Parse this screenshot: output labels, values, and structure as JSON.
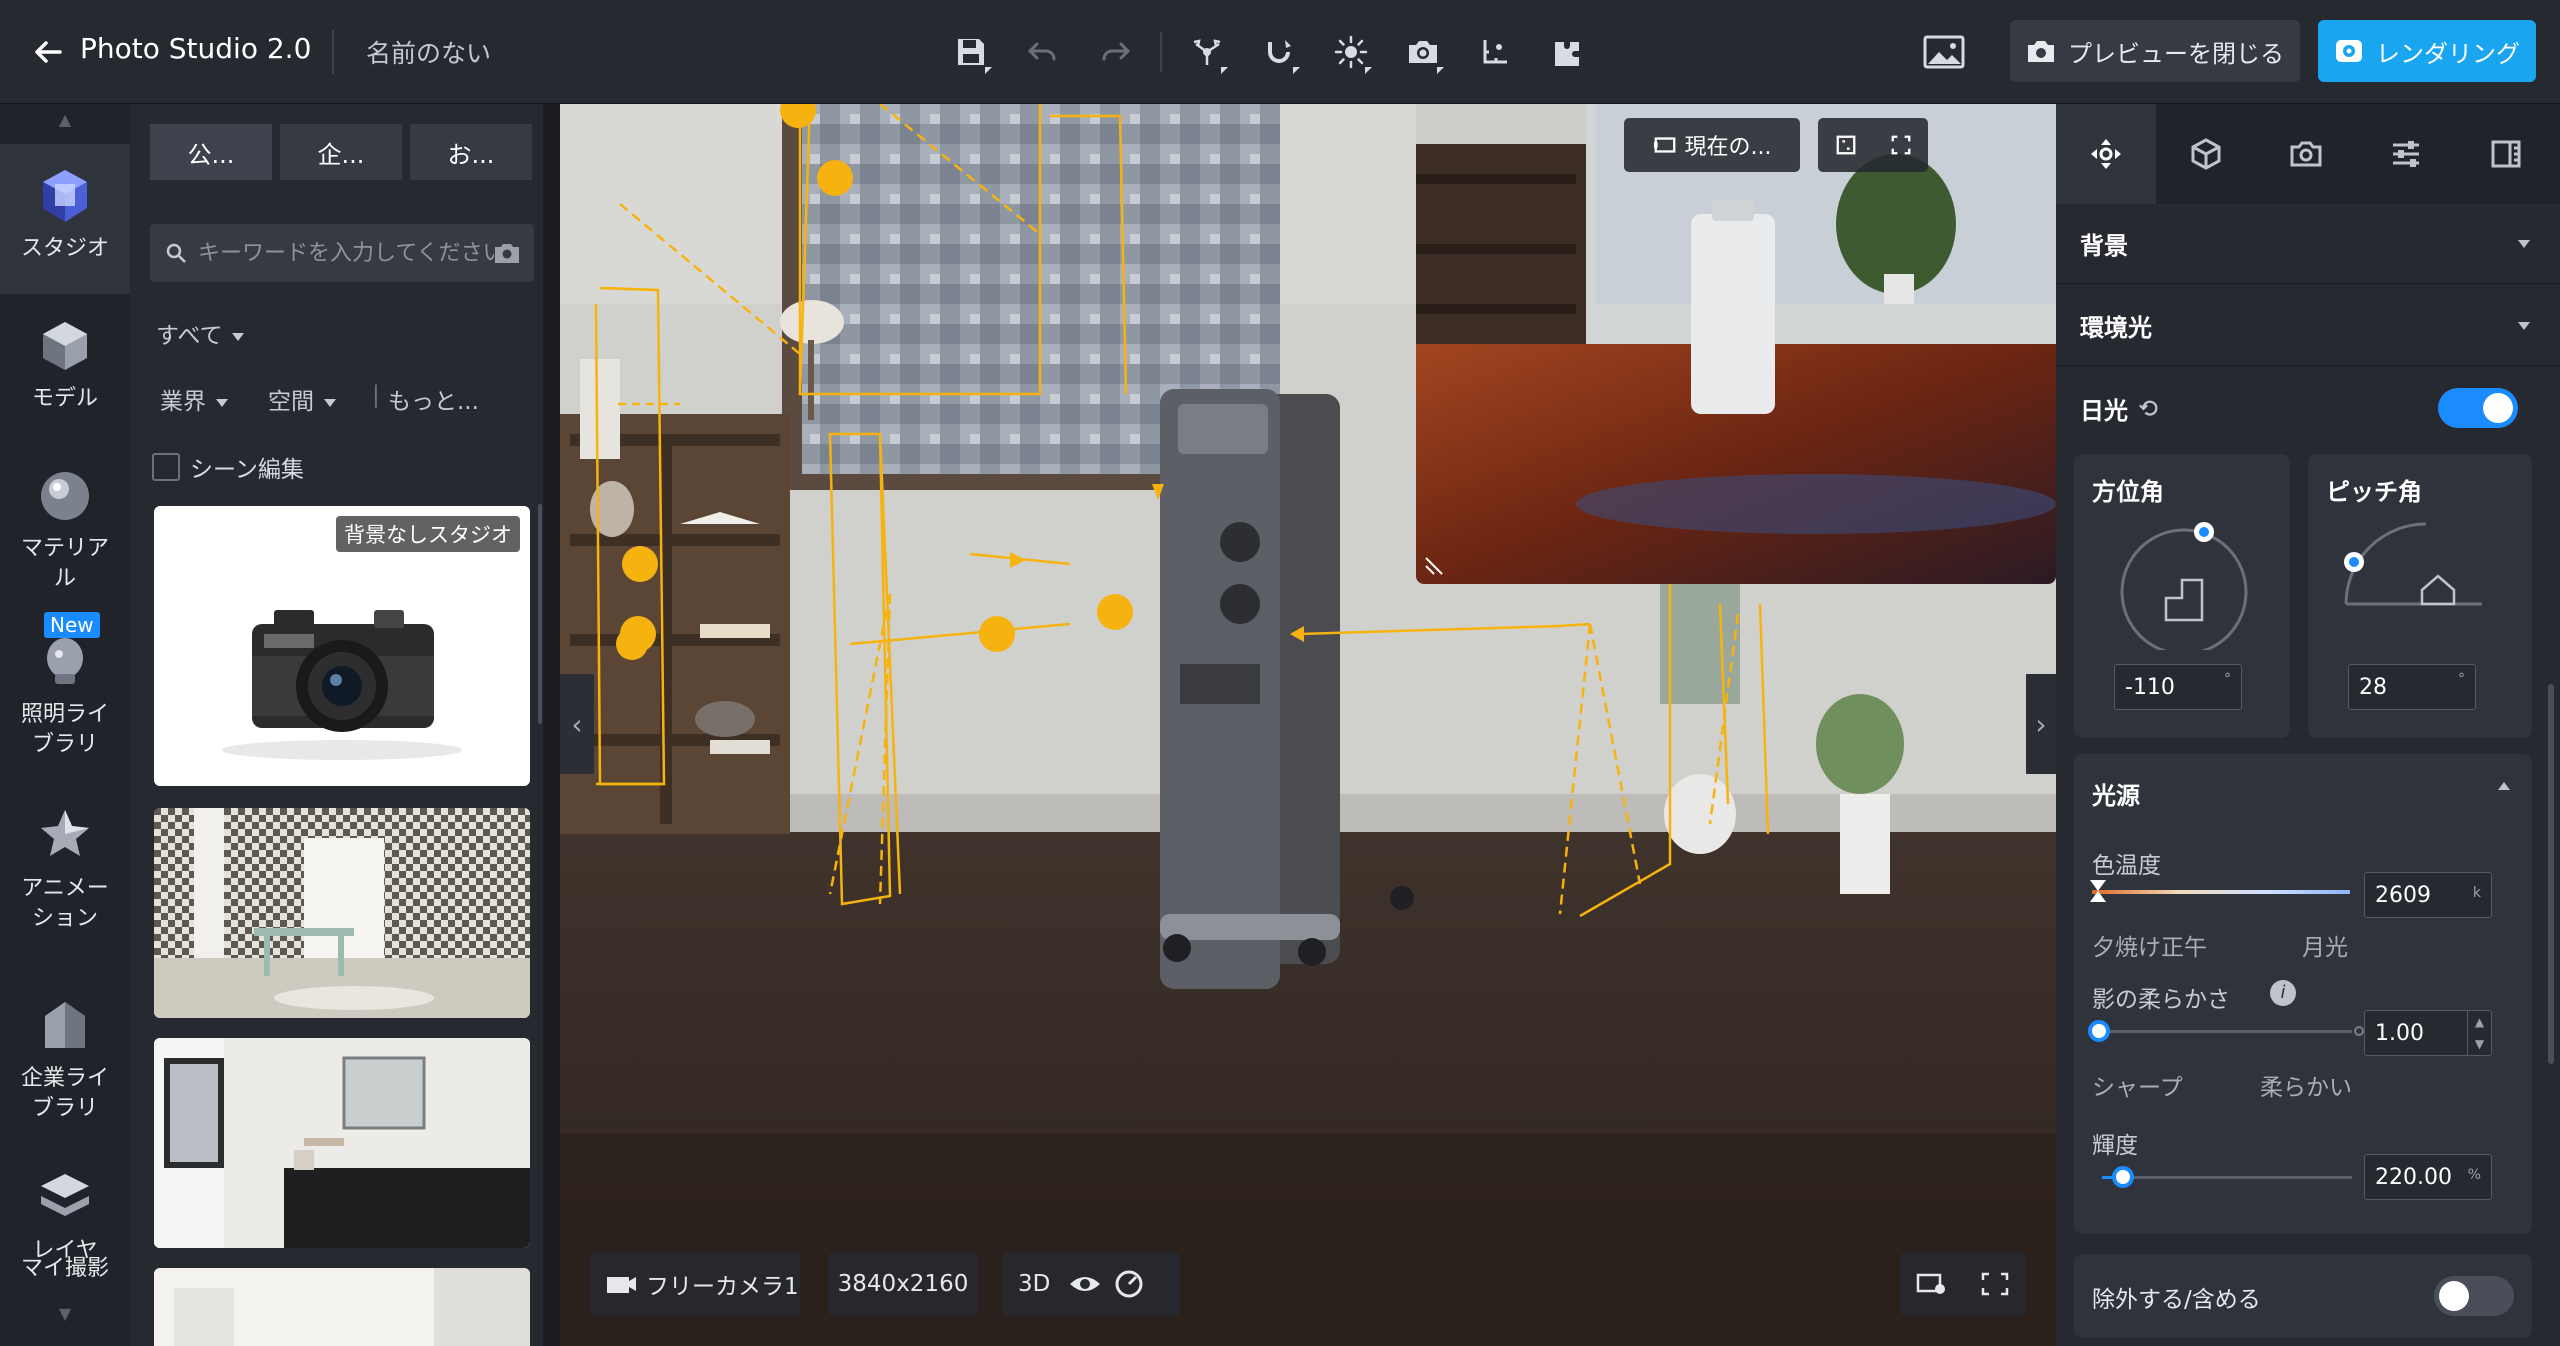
{
  "header": {
    "app_title": "Photo Studio 2.0",
    "doc_name": "名前のない",
    "preview_close_label": "プレビューを閉じる",
    "render_label": "レンダリング"
  },
  "rail": {
    "items": [
      {
        "label": "スタジオ",
        "icon": "studio-icon",
        "active": true
      },
      {
        "label": "モデル",
        "icon": "model-icon"
      },
      {
        "label": "マテリアル",
        "icon": "material-icon"
      },
      {
        "label": "照明ライブラリ",
        "icon": "light-icon",
        "badge": "New"
      },
      {
        "label": "アニメーション",
        "icon": "animation-icon"
      },
      {
        "label": "企業ライブラリ",
        "icon": "enterprise-icon"
      },
      {
        "label": "レイヤ",
        "icon": "layer-icon"
      },
      {
        "label": "マイ撮影",
        "icon": "my-shots-icon"
      }
    ]
  },
  "library": {
    "tabs": [
      "公...",
      "企...",
      "お..."
    ],
    "search_placeholder": "キーワードを入力してください",
    "filter_all": "すべて",
    "filter_industry": "業界",
    "filter_space": "空間",
    "filter_more": "もっと...",
    "scene_edit_label": "シーン編集",
    "cards": [
      {
        "badge": "背景なしスタジオ"
      },
      {},
      {},
      {}
    ]
  },
  "viewport": {
    "camera_label": "フリーカメラ1",
    "resolution": "3840x2160",
    "mode_3d": "3D",
    "preview_current_label": "現在の..."
  },
  "right_panel": {
    "sections": {
      "background": "背景",
      "ambient": "環境光",
      "sunlight": "日光",
      "light_source": "光源",
      "exclude_include": "除外する/含める"
    },
    "sunlight_enabled": true,
    "exclude_enabled": false,
    "azimuth": {
      "label": "方位角",
      "value": "-110",
      "unit": "°"
    },
    "pitch": {
      "label": "ピッチ角",
      "value": "28",
      "unit": "°"
    },
    "color_temp": {
      "label": "色温度",
      "value": "2609",
      "unit": "k",
      "left_label": "夕焼け正午",
      "right_label": "月光"
    },
    "shadow_softness": {
      "label": "影の柔らかさ",
      "value": "1.00",
      "left_label": "シャープ",
      "right_label": "柔らかい"
    },
    "brightness": {
      "label": "輝度",
      "value": "220.00",
      "unit": "%"
    }
  },
  "colors": {
    "accent": "#1a8cff",
    "render_button": "#1aa5f0",
    "gizmo": "#f6b30f"
  }
}
